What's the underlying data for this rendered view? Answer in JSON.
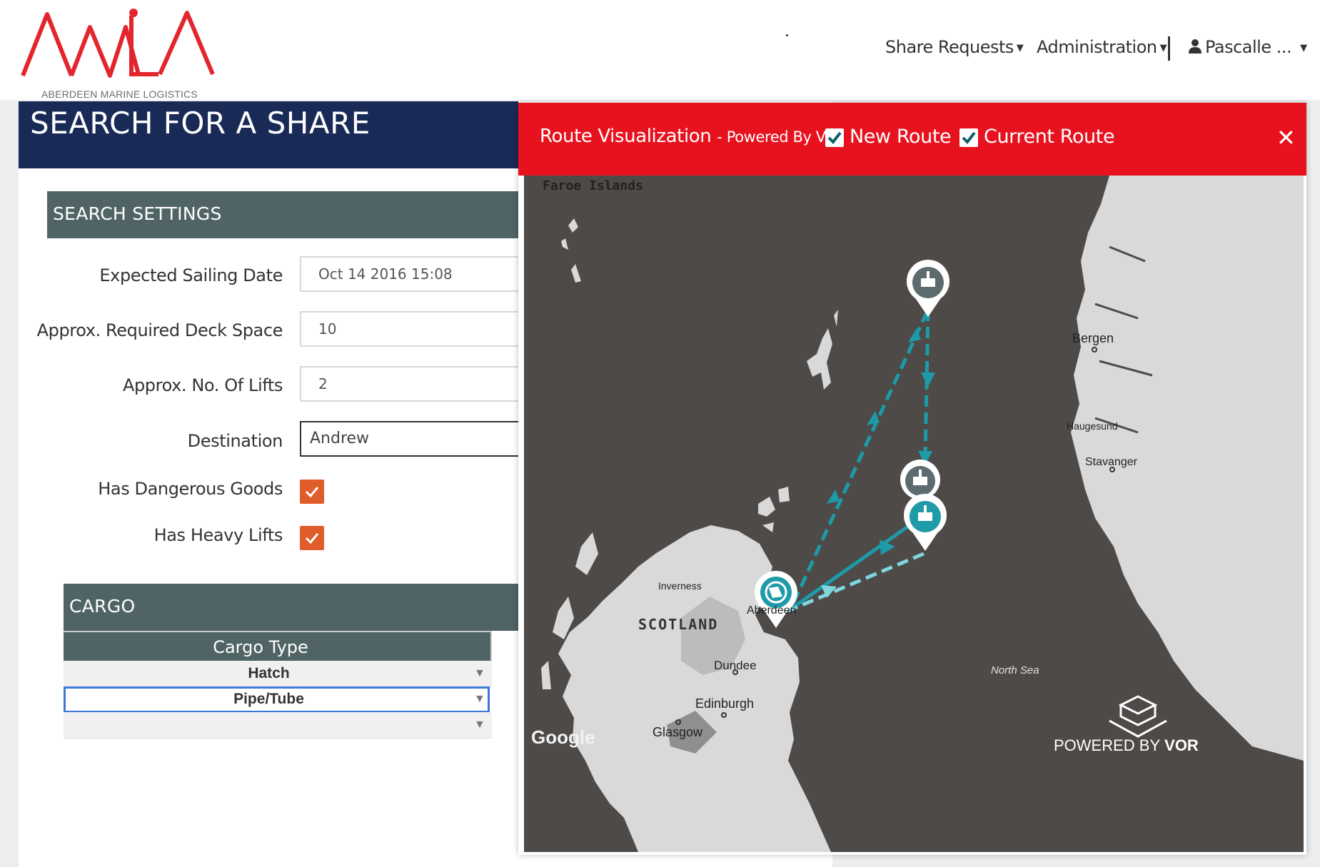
{
  "header": {
    "logo_text": "AMLA",
    "logo_caption": "ABERDEEN MARINE LOGISTICS ALLIANCE",
    "nav": [
      {
        "label": "Share Requests"
      },
      {
        "label": "Administration"
      }
    ],
    "user": {
      "label": "Pascalle ..."
    }
  },
  "page": {
    "title": "SEARCH FOR A SHARE"
  },
  "search_settings": {
    "heading": "SEARCH SETTINGS",
    "fields": {
      "sailing_date": {
        "label": "Expected Sailing Date",
        "value": "Oct 14 2016 15:08"
      },
      "deck_space": {
        "label": "Approx. Required Deck Space",
        "value": "10"
      },
      "lifts": {
        "label": "Approx. No. Of Lifts",
        "value": "2"
      },
      "destination": {
        "label": "Destination",
        "value": "Andrew"
      }
    },
    "checks": {
      "dangerous": {
        "label": "Has Dangerous Goods",
        "checked": true
      },
      "heavy": {
        "label": "Has Heavy Lifts",
        "checked": true
      }
    }
  },
  "cargo": {
    "heading": "CARGO",
    "column": "Cargo Type",
    "rows": [
      "Hatch",
      "Pipe/Tube",
      ""
    ]
  },
  "modal": {
    "title": "Route Visualization",
    "subtitle": "- Powered By Vor",
    "new_route": {
      "label": "New Route",
      "checked": true
    },
    "current_route": {
      "label": "Current Route",
      "checked": true
    },
    "close_symbol": "✕"
  },
  "map": {
    "labels": {
      "faroe": "Faroe Islands",
      "bergen": "Bergen",
      "haugesund": "Haugesund",
      "stavanger": "Stavanger",
      "inverness": "Inverness",
      "scotland": "SCOTLAND",
      "aberdeen": "Aberdeen",
      "dundee": "Dundee",
      "edinburgh": "Edinburgh",
      "glasgow": "Glasgow",
      "north_sea": "North Sea",
      "google": "Google",
      "powered_prefix": "POWERED BY",
      "powered_brand": "VOR"
    },
    "colors": {
      "water": "#4d4a48",
      "land": "#d9d9d9",
      "route": "#1e9aa8",
      "route_dashed": "#7fd6df",
      "marker": "#5d6b6f"
    }
  }
}
